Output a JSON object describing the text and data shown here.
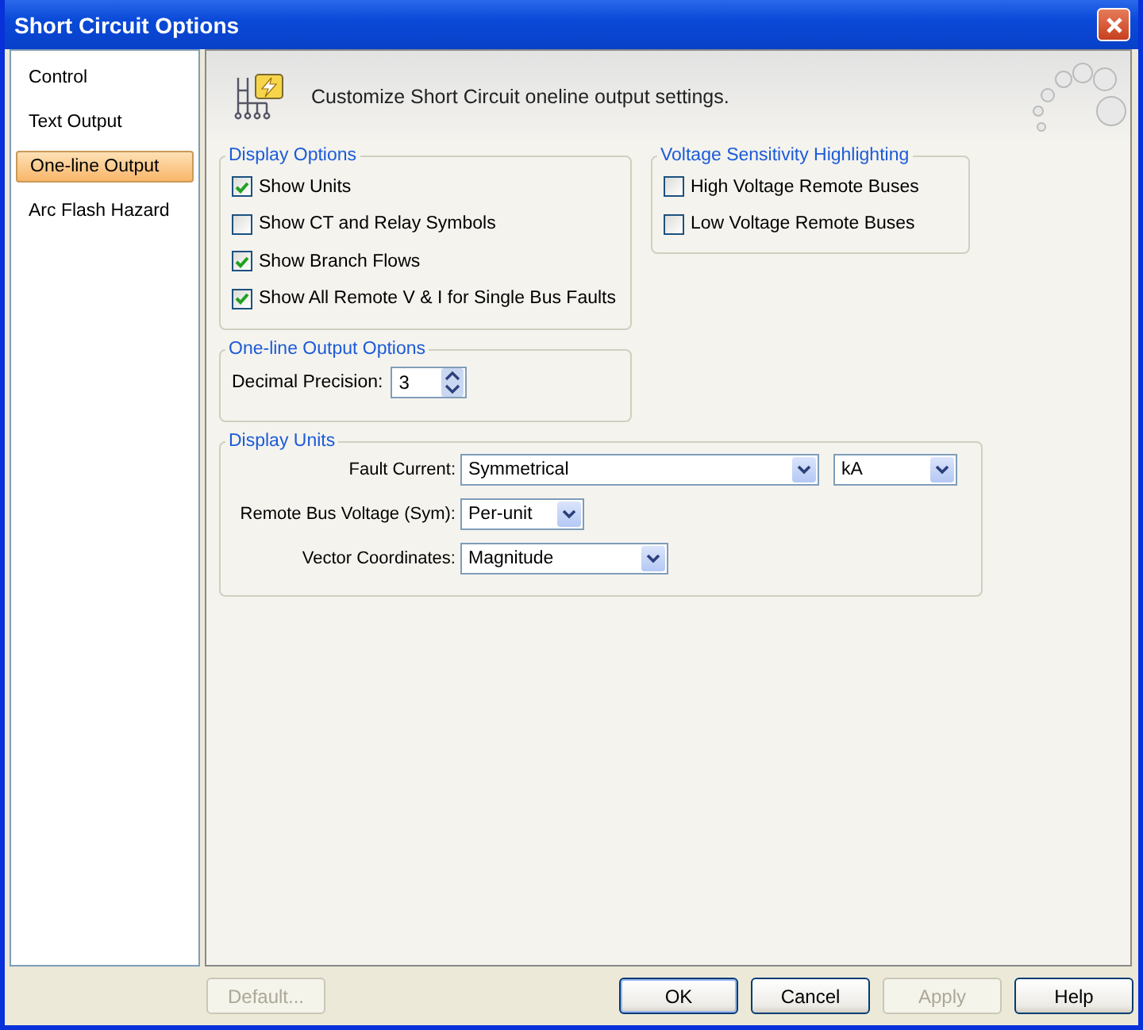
{
  "window": {
    "title": "Short Circuit Options"
  },
  "sidebar": {
    "items": [
      {
        "label": "Control",
        "selected": false
      },
      {
        "label": "Text Output",
        "selected": false
      },
      {
        "label": "One-line Output",
        "selected": true
      },
      {
        "label": "Arc Flash Hazard",
        "selected": false
      }
    ]
  },
  "header": {
    "text": "Customize Short Circuit oneline output settings."
  },
  "display_options": {
    "title": "Display Options",
    "items": [
      {
        "label": "Show Units",
        "checked": true
      },
      {
        "label": "Show CT and Relay Symbols",
        "checked": false
      },
      {
        "label": "Show Branch Flows",
        "checked": true
      },
      {
        "label": "Show All Remote V & I for Single Bus Faults",
        "checked": true
      }
    ]
  },
  "voltage_sensitivity": {
    "title": "Voltage Sensitivity Highlighting",
    "items": [
      {
        "label": "High Voltage Remote Buses",
        "checked": false
      },
      {
        "label": "Low Voltage Remote Buses",
        "checked": false
      }
    ]
  },
  "output_options": {
    "title": "One-line Output Options",
    "decimal_precision": {
      "label": "Decimal Precision:",
      "value": "3"
    }
  },
  "display_units": {
    "title": "Display Units",
    "rows": [
      {
        "label": "Fault Current:",
        "dropdowns": [
          {
            "value": "Symmetrical"
          },
          {
            "value": "kA"
          }
        ]
      },
      {
        "label": "Remote Bus Voltage (Sym):",
        "dropdowns": [
          {
            "value": "Per-unit"
          }
        ]
      },
      {
        "label": "Vector Coordinates:",
        "dropdowns": [
          {
            "value": "Magnitude"
          }
        ]
      }
    ]
  },
  "buttons": [
    {
      "label": "Default...",
      "disabled": true,
      "default": false
    },
    {
      "label": "OK",
      "disabled": false,
      "default": true
    },
    {
      "label": "Cancel",
      "disabled": false,
      "default": false
    },
    {
      "label": "Apply",
      "disabled": true,
      "default": false
    },
    {
      "label": "Help",
      "disabled": false,
      "default": false
    }
  ]
}
